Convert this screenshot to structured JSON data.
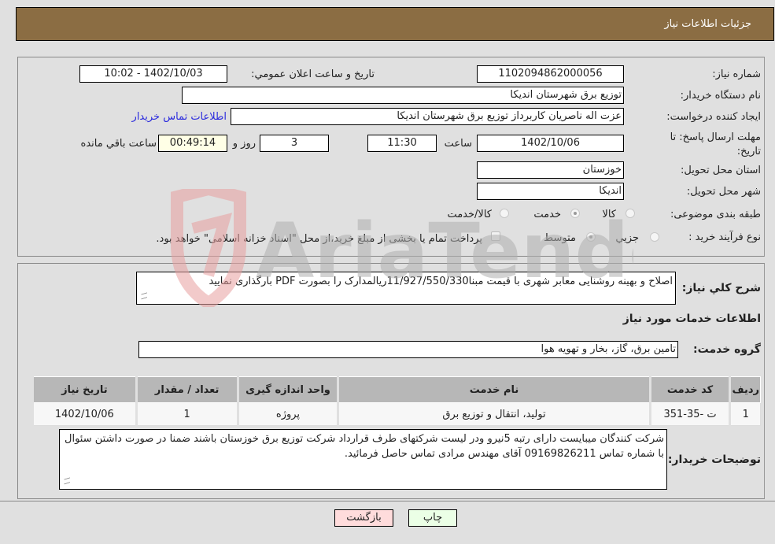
{
  "header": {
    "title": "جزئیات اطلاعات نیاز"
  },
  "fields": {
    "need_number_label": "شماره نیاز:",
    "need_number": "1102094862000056",
    "announce_label": "تاریخ و ساعت اعلان عمومي:",
    "announce_value": "1402/10/03 - 10:02",
    "buyer_org_label": "نام دستگاه خریدار:",
    "buyer_org": "توزیع برق شهرستان اندیکا",
    "creator_label": "ایجاد کننده درخواست:",
    "creator": "عزت اله ناصریان کاربرداز توزیع برق شهرستان اندیکا",
    "buyer_contact_link": "اطلاعات تماس خریدار",
    "deadline_label": "مهلت ارسال پاسخ: تا تاریخ:",
    "deadline_date": "1402/10/06",
    "time_label": "ساعت",
    "deadline_time": "11:30",
    "days_value": "3",
    "days_label": "روز و",
    "remaining_time": "00:49:14",
    "remaining_label": "ساعت باقي مانده",
    "province_label": "استان محل تحویل:",
    "province": "خوزستان",
    "city_label": "شهر محل تحویل:",
    "city": "اندیکا",
    "category_label": "طبقه بندی موضوعی:",
    "category_options": [
      "کالا",
      "خدمت",
      "کالا/خدمت"
    ],
    "category_selected": "خدمت",
    "process_label": "نوع فرآیند خرید :",
    "process_options": [
      "جزيي",
      "متوسط"
    ],
    "process_selected": "متوسط",
    "treasury_note": "پرداخت تمام یا بخشی از مبلغ خرید،از محل \"اسناد خزانه اسلامی\" خواهد بود."
  },
  "description": {
    "label": "شرح كلي نياز:",
    "value": "اصلاح و بهینه روشنایی معابر شهری با قیمت مبنا11/927/550/330ریالمدارک را بصورت PDF بارگذاری نمایید"
  },
  "services": {
    "section_title": "اطلاعات خدمات مورد نیاز",
    "group_label": "گروه خدمت:",
    "group_value": "تامین برق، گاز، بخار و تهویه هوا",
    "columns": [
      "ردیف",
      "کد خدمت",
      "نام خدمت",
      "واحد اندازه گیری",
      "تعداد / مقدار",
      "تاریخ نیاز"
    ],
    "rows": [
      [
        "1",
        "ت -35-351",
        "تولید، انتقال و توزیع برق",
        "پروژه",
        "1",
        "1402/10/06"
      ]
    ]
  },
  "buyer_notes": {
    "label": "توضیحات خریدار:",
    "value": "شرکت کنندگان میبایست دارای رتبه 5نیرو  ودر لیست شرکتهای طرف قرارداد شرکت توزیع برق خوزستان باشند ضمنا در صورت داشتن سئوال با شماره تماس 09169826211 آقای مهندس مرادی تماس حاصل فرمائید."
  },
  "buttons": {
    "print": "چاپ",
    "back": "بازگشت"
  },
  "watermark": {
    "text": "AriaTender.neT"
  },
  "colors": {
    "header_bg": "#8b6d43",
    "link": "#2b2bdd",
    "back_bg": "#ffdcdc",
    "print_bg": "#ebffe6",
    "remaining_bg": "#ffffe6"
  }
}
